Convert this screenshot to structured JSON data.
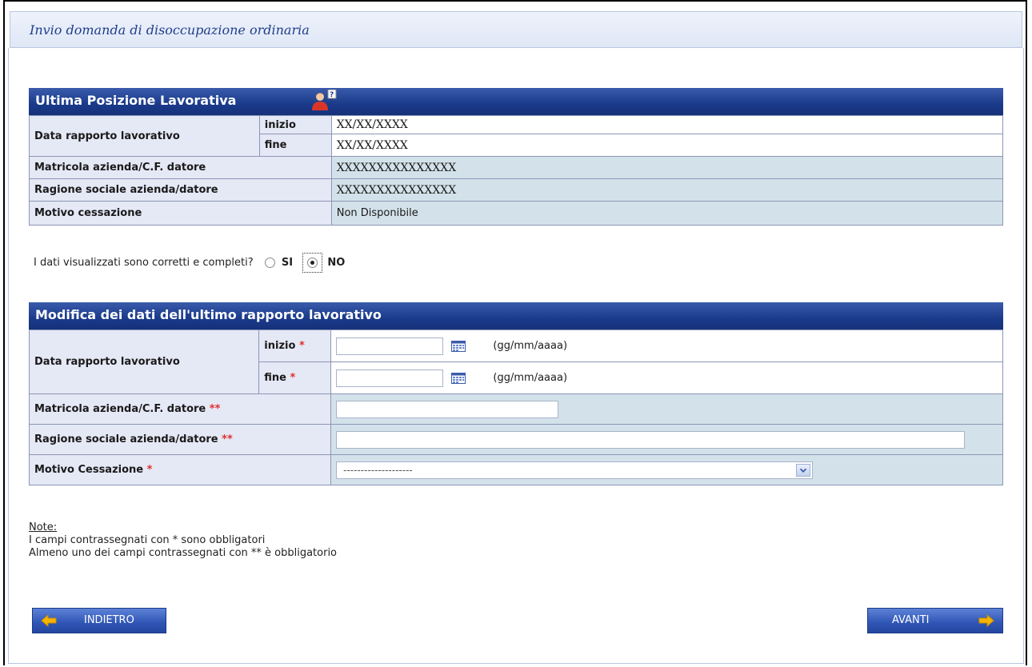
{
  "page": {
    "title": "Invio domanda di disoccupazione ordinaria"
  },
  "section1": {
    "title": "Ultima Posizione Lavorativa",
    "help_icon": "user-help-icon",
    "rows": {
      "data_label": "Data rapporto lavorativo",
      "inizio_label": "inizio",
      "inizio_value": "XX/XX/XXXX",
      "fine_label": "fine",
      "fine_value": "XX/XX/XXXX",
      "matricola_label": "Matricola azienda/C.F. datore",
      "matricola_value": "XXXXXXXXXXXXXXX",
      "ragione_label": "Ragione sociale azienda/datore",
      "ragione_value": "XXXXXXXXXXXXXXX",
      "motivo_label": "Motivo cessazione",
      "motivo_value": "Non Disponibile"
    }
  },
  "question": {
    "text": "I dati visualizzati sono corretti e completi?",
    "si_label": "SI",
    "no_label": "NO",
    "selected": "NO"
  },
  "section2": {
    "title": "Modifica dei dati dell'ultimo rapporto lavorativo",
    "data_label": "Data rapporto lavorativo",
    "inizio_label": "inizio",
    "fine_label": "fine",
    "required_star": "*",
    "optional_star": "**",
    "date_format": "(gg/mm/aaaa)",
    "inizio_value": "",
    "fine_value": "",
    "matricola_label": "Matricola azienda/C.F. datore",
    "matricola_value": "",
    "ragione_label": "Ragione sociale azienda/datore",
    "ragione_value": "",
    "motivo_label": "Motivo Cessazione",
    "motivo_selected": "--------------------"
  },
  "notes": {
    "title": "Note:",
    "line1": "I campi contrassegnati con * sono obbligatori",
    "line2": "Almeno uno dei campi contrassegnati con ** è obbligatorio"
  },
  "buttons": {
    "back": "INDIETRO",
    "next": "AVANTI"
  },
  "colors": {
    "header_bar": "#1a3a8a",
    "label_bg": "#e5e8f5",
    "value_bg": "#d3e2ea",
    "required": "#e03030"
  }
}
